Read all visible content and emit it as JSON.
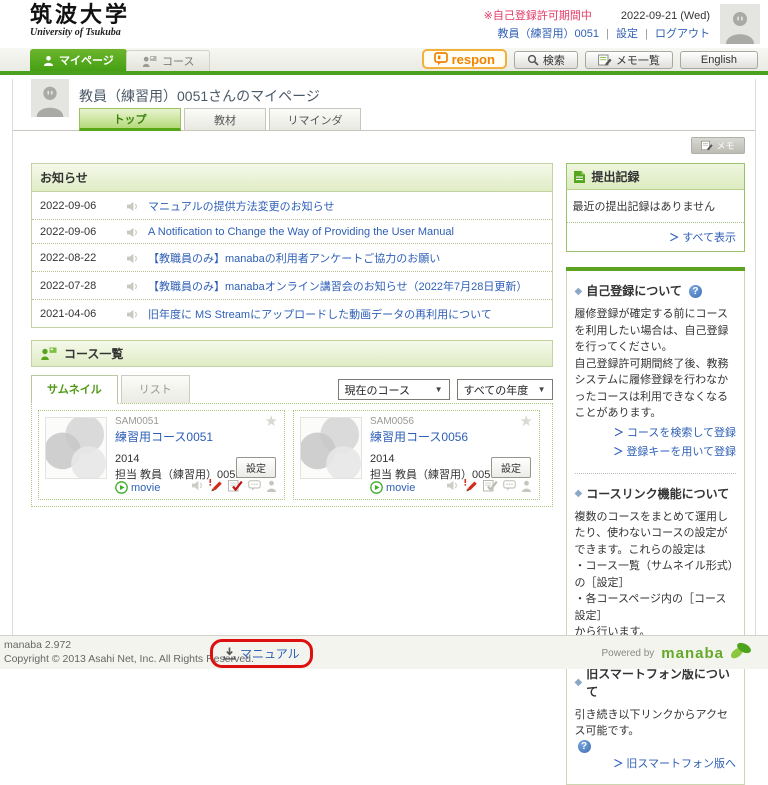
{
  "header": {
    "logo_title": "筑波大学",
    "logo_subtitle": "University of Tsukuba",
    "notice_red": "※自己登録許可期間中",
    "date": "2022-09-21 (Wed)",
    "user_name": "教員（練習用）0051",
    "settings_label": "設定",
    "logout_label": "ログアウト",
    "sep": "|"
  },
  "nav": {
    "mypage_tab": "マイページ",
    "course_tab": "コース",
    "respon_label": "respon",
    "search_label": "検索",
    "memo_list_label": "メモ一覧",
    "english_label": "English"
  },
  "page": {
    "title": "教員（練習用）0051さんのマイページ",
    "tab_top": "トップ",
    "tab_materials": "教材",
    "tab_reminder": "リマインダ",
    "memo_button": "メモ"
  },
  "announcements": {
    "title": "お知らせ",
    "items": [
      {
        "date": "2022-09-06",
        "text": "マニュアルの提供方法変更のお知らせ"
      },
      {
        "date": "2022-09-06",
        "text": "A Notification to Change the Way of Providing the User Manual"
      },
      {
        "date": "2022-08-22",
        "text": "【教職員のみ】manabaの利用者アンケートご協力のお願い"
      },
      {
        "date": "2022-07-28",
        "text": "【教職員のみ】manabaオンライン講習会のお知らせ（2022年7月28日更新）"
      },
      {
        "date": "2021-04-06",
        "text": "旧年度に MS Streamにアップロードした動画データの再利用について"
      }
    ]
  },
  "course_list": {
    "title": "コース一覧",
    "tab_thumbnail": "サムネイル",
    "tab_list": "リスト",
    "filter_course": "現在のコース",
    "filter_year": "すべての年度",
    "courses": [
      {
        "code": "SAM0051",
        "name": "練習用コース0051",
        "year": "2014",
        "teacher": "担当 教員（練習用）0051",
        "settings_label": "設定",
        "movie_label": "movie"
      },
      {
        "code": "SAM0056",
        "name": "練習用コース0056",
        "year": "2014",
        "teacher": "担当 教員（練習用）0056",
        "settings_label": "設定",
        "movie_label": "movie"
      }
    ]
  },
  "sidebar": {
    "submissions": {
      "title": "提出記録",
      "empty_text": "最近の提出記録はありません",
      "view_all": "すべて表示"
    },
    "self_registration": {
      "title": "自己登録について",
      "body1": "履修登録が確定する前にコースを利用したい場合は、自己登録を行ってください。",
      "body2": "自己登録許可期間終了後、教務システムに履修登録を行わなかったコースは利用できなくなることがあります。",
      "link1": "コースを検索して登録",
      "link2": "登録キーを用いて登録"
    },
    "course_link": {
      "title": "コースリンク機能について",
      "body1": "複数のコースをまとめて運用したり、使わないコースの設定ができます。これらの設定は",
      "body2": "・コース一覧（サムネイル形式）の［設定］",
      "body3": "・各コースページ内の［コース設定］",
      "body4": "から行います。"
    },
    "old_smartphone": {
      "title": "旧スマートフォン版について",
      "body": "引き続き以下リンクからアクセス可能です。",
      "link": "旧スマートフォン版へ"
    }
  },
  "footer": {
    "version": "manaba 2.972",
    "copyright": "Copyright © 2013 Asahi Net, Inc. All Rights Reserved.",
    "manual_label": "マニュアル",
    "powered_by": "Powered by",
    "brand": "manaba"
  },
  "icons": {
    "arrow": "＞",
    "star": "★",
    "diamond": "◆",
    "question": "?",
    "caret": "▼"
  },
  "colors": {
    "accent_green": "#4ba11e",
    "link_blue": "#2e5fb7",
    "notice_red": "#e23a66",
    "respon_orange": "#f08300",
    "annotation_red": "#dd1010"
  }
}
